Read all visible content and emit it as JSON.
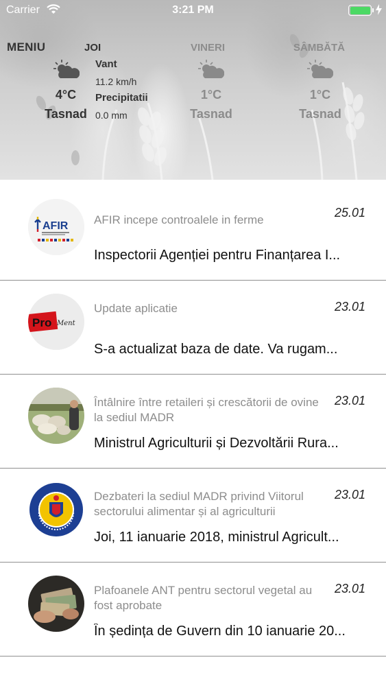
{
  "status_bar": {
    "carrier": "Carrier",
    "time": "3:21 PM",
    "battery_level": 1.0
  },
  "header": {
    "menu_label": "MENIU"
  },
  "weather": {
    "today": {
      "day": "JOI",
      "icon": "partly-cloudy-icon",
      "temperature": "4°C",
      "city": "Tasnad",
      "wind_label": "Vant",
      "wind_value": "11.2 km/h",
      "precip_label": "Precipitatii",
      "precip_value": "0.0 mm"
    },
    "forecast": [
      {
        "day": "VINERI",
        "icon": "partly-cloudy-icon",
        "temperature": "1°C",
        "city": "Tasnad"
      },
      {
        "day": "SÂMBĂTĂ",
        "icon": "partly-cloudy-icon",
        "temperature": "1°C",
        "city": "Tasnad"
      }
    ]
  },
  "news": [
    {
      "thumb": "afir-logo",
      "thumb_text": "AFIR",
      "title": "AFIR incepe controalele in ferme",
      "date": "25.01",
      "summary": "Inspectorii Agenției pentru Finanțarea I..."
    },
    {
      "thumb": "pro-logo",
      "thumb_text": "Pro",
      "thumb_text_2": "Ment",
      "title": "Update aplicatie",
      "date": "23.01",
      "summary": "S-a actualizat baza de date. Va rugam..."
    },
    {
      "thumb": "sheep-photo",
      "title": "Întâlnire între retaileri și crescătorii de ovine la sediul MADR",
      "date": "23.01",
      "summary": "Ministrul Agriculturii și Dezvoltării Rura..."
    },
    {
      "thumb": "madr-seal",
      "title": "Dezbateri la sediul MADR privind Viitorul sectorului alimentar și al agriculturii",
      "date": "23.01",
      "summary": "Joi, 11 ianuarie 2018, ministrul Agricult..."
    },
    {
      "thumb": "money-photo",
      "title": "Plafoanele ANT pentru sectorul vegetal au fost aprobate",
      "date": "23.01",
      "summary": "În ședința de Guvern din 10 ianuarie 20..."
    }
  ],
  "colors": {
    "battery": "#4cd964",
    "title_gray": "#8d8d8d",
    "divider": "#8f8f8f"
  }
}
